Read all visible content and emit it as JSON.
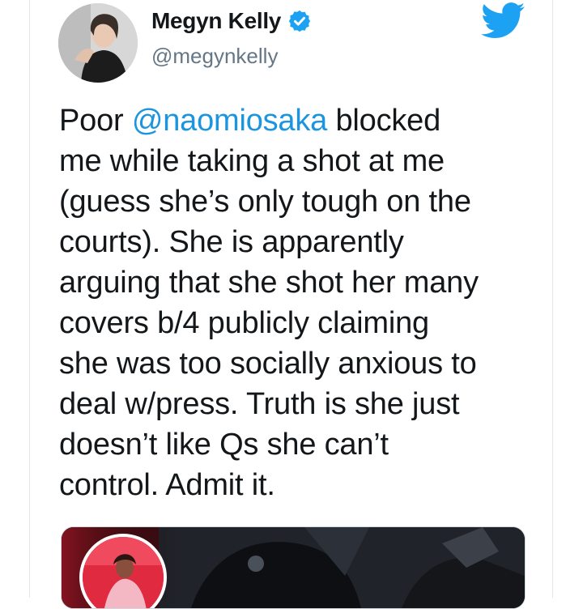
{
  "tweet": {
    "author_name": "Megyn Kelly",
    "author_handle": "@megynkelly",
    "lines": [
      [
        "Poor ",
        "@naomiosaka",
        " blocked"
      ],
      [
        "me while taking a shot at me"
      ],
      [
        "(guess she’s only tough on the"
      ],
      [
        "courts). She is apparently"
      ],
      [
        "arguing that she shot her many"
      ],
      [
        "covers b/4 publicly claiming"
      ],
      [
        "she was too socially anxious to"
      ],
      [
        "deal w/press. Truth is she just"
      ],
      [
        "doesn’t like Qs she can’t"
      ],
      [
        "control. Admit it."
      ]
    ]
  },
  "icons": {
    "verified": "verified-badge-icon",
    "brand": "twitter-bird-icon"
  },
  "colors": {
    "mention": "#1b95e0",
    "brand": "#1da1f2",
    "text": "#14171a",
    "handle": "#657786"
  }
}
